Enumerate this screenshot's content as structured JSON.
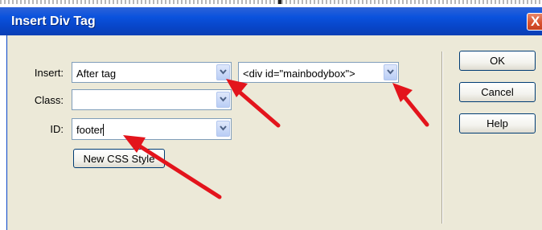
{
  "dialog": {
    "title": "Insert Div Tag",
    "close_glyph": "X"
  },
  "form": {
    "insert_label": "Insert:",
    "insert_value": "After tag",
    "insert_target_value": "<div id=\"mainbodybox\">",
    "class_label": "Class:",
    "class_value": "",
    "id_label": "ID:",
    "id_value": "footer",
    "new_css_style_label": "New CSS Style"
  },
  "buttons": {
    "ok": "OK",
    "cancel": "Cancel",
    "help": "Help"
  },
  "colors": {
    "titlebar": "#0a52dd",
    "dialog_body": "#ece9d8",
    "annotation_arrow": "#e3141c"
  },
  "icons": [
    "close-icon",
    "chevron-down-icon"
  ]
}
